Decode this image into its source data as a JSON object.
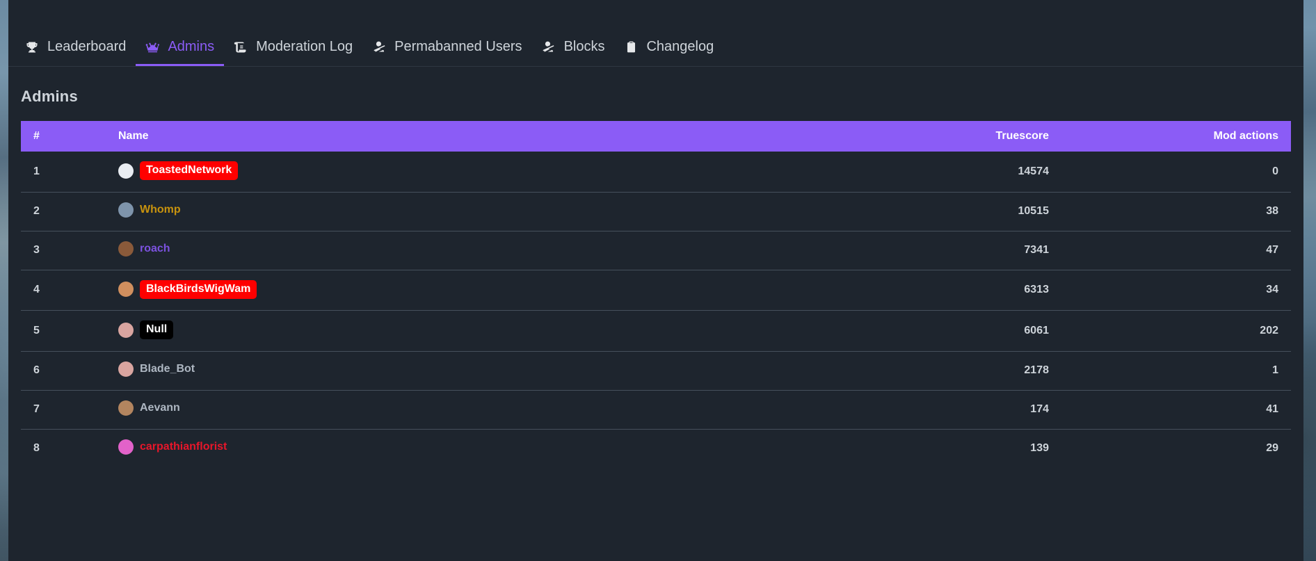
{
  "theme": {
    "accent": "#8b5cf6",
    "surface": "#1e252e",
    "text": "#ced4da",
    "divider": "#46505c"
  },
  "tabs": [
    {
      "id": "leaderboard",
      "label": "Leaderboard",
      "icon": "trophy-icon",
      "active": false
    },
    {
      "id": "admins",
      "label": "Admins",
      "icon": "crown-icon",
      "active": true
    },
    {
      "id": "moderation-log",
      "label": "Moderation Log",
      "icon": "scroll-icon",
      "active": false
    },
    {
      "id": "permabanned-users",
      "label": "Permabanned Users",
      "icon": "user-slash-icon",
      "active": false
    },
    {
      "id": "blocks",
      "label": "Blocks",
      "icon": "user-slash-icon",
      "active": false
    },
    {
      "id": "changelog",
      "label": "Changelog",
      "icon": "clipboard-icon",
      "active": false
    }
  ],
  "page": {
    "title": "Admins"
  },
  "table": {
    "columns": [
      {
        "key": "rank",
        "label": "#",
        "align": "left"
      },
      {
        "key": "name",
        "label": "Name",
        "align": "left"
      },
      {
        "key": "score",
        "label": "Truescore",
        "align": "right"
      },
      {
        "key": "mod",
        "label": "Mod actions",
        "align": "right"
      }
    ],
    "rows": [
      {
        "rank": "1",
        "name": "ToastedNetwork",
        "score": "14574",
        "mod": "0",
        "name_color": "#ffffff",
        "badge_color": "#ff0000",
        "avatar_color": "#e9edf2"
      },
      {
        "rank": "2",
        "name": "Whomp",
        "score": "10515",
        "mod": "38",
        "name_color": "#c8930e",
        "badge_color": "",
        "avatar_color": "#7e94ab"
      },
      {
        "rank": "3",
        "name": "roach",
        "score": "7341",
        "mod": "47",
        "name_color": "#7c52e0",
        "badge_color": "",
        "avatar_color": "#8a5a3a"
      },
      {
        "rank": "4",
        "name": "BlackBirdsWigWam",
        "score": "6313",
        "mod": "34",
        "name_color": "#ffffff",
        "badge_color": "#ff0000",
        "avatar_color": "#d08f5e"
      },
      {
        "rank": "5",
        "name": "Null",
        "score": "6061",
        "mod": "202",
        "name_color": "#ffffff",
        "badge_color": "#000000",
        "avatar_color": "#d9a5a0"
      },
      {
        "rank": "6",
        "name": "Blade_Bot",
        "score": "2178",
        "mod": "1",
        "name_color": "#aeb7c2",
        "badge_color": "",
        "avatar_color": "#d9a5a0"
      },
      {
        "rank": "7",
        "name": "Aevann",
        "score": "174",
        "mod": "41",
        "name_color": "#aeb7c2",
        "badge_color": "",
        "avatar_color": "#b3855f"
      },
      {
        "rank": "8",
        "name": "carpathianflorist",
        "score": "139",
        "mod": "29",
        "name_color": "#e8162a",
        "badge_color": "",
        "avatar_color": "#e262c9"
      }
    ]
  }
}
